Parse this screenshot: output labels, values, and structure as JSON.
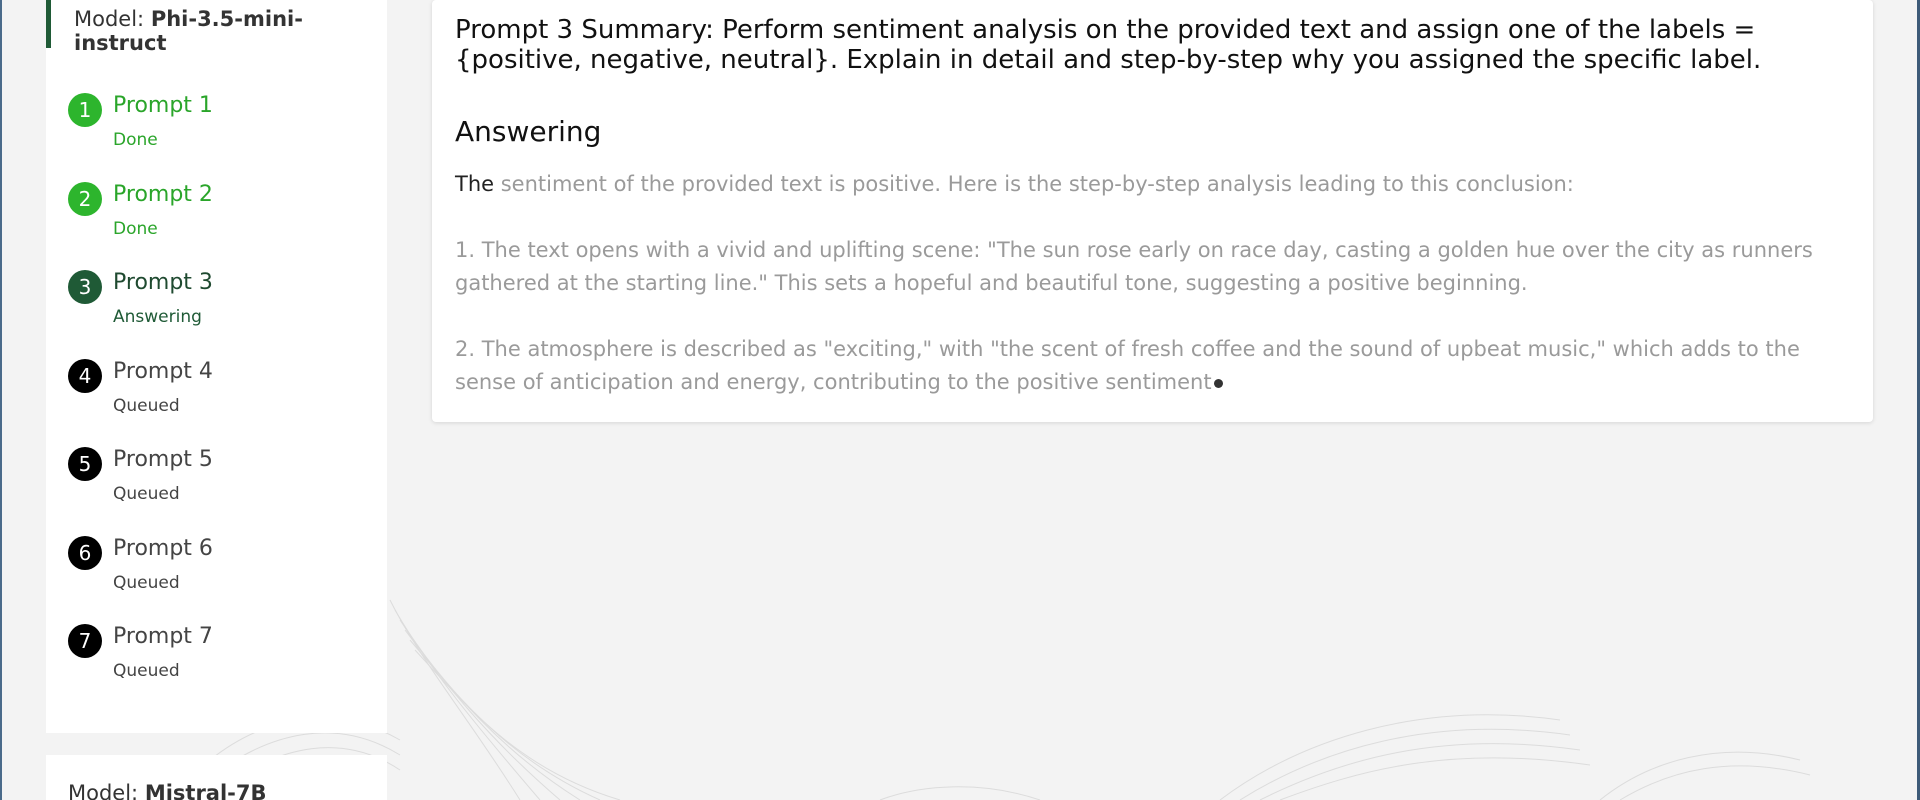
{
  "sidebar": {
    "model_prefix": "Model: ",
    "model_name": "Phi-3.5-mini-instruct",
    "prompts": [
      {
        "number": "1",
        "title": "Prompt 1",
        "status": "Done"
      },
      {
        "number": "2",
        "title": "Prompt 2",
        "status": "Done"
      },
      {
        "number": "3",
        "title": "Prompt 3",
        "status": "Answering"
      },
      {
        "number": "4",
        "title": "Prompt 4",
        "status": "Queued"
      },
      {
        "number": "5",
        "title": "Prompt 5",
        "status": "Queued"
      },
      {
        "number": "6",
        "title": "Prompt 6",
        "status": "Queued"
      },
      {
        "number": "7",
        "title": "Prompt 7",
        "status": "Queued"
      }
    ]
  },
  "next_model": {
    "model_prefix": "Model: ",
    "model_name": "Mistral-7B"
  },
  "main": {
    "prompt_summary": "Prompt 3 Summary: Perform sentiment analysis on the provided text and assign one of the labels = {positive, negative, neutral}. Explain in detail and step-by-step why you assigned the specific label.",
    "answer_heading": "Answering",
    "answer_lead_word": "The",
    "answer_intro_rest": " sentiment of the provided text is positive. Here is the step-by-step analysis leading to this conclusion:",
    "answer_point_1": "1. The text opens with a vivid and uplifting scene: \"The sun rose early on race day, casting a golden hue over the city as runners gathered at the starting line.\" This sets a hopeful and beautiful tone, suggesting a positive beginning.",
    "answer_point_2": "2. The atmosphere is described as \"exciting,\" with \"the scent of fresh coffee and the sound of upbeat music,\" which adds to the sense of anticipation and energy, contributing to the positive sentiment"
  },
  "colors": {
    "done": "#2db52d",
    "active": "#1f5a36",
    "queued": "#000000",
    "background": "#f3f3f3"
  }
}
